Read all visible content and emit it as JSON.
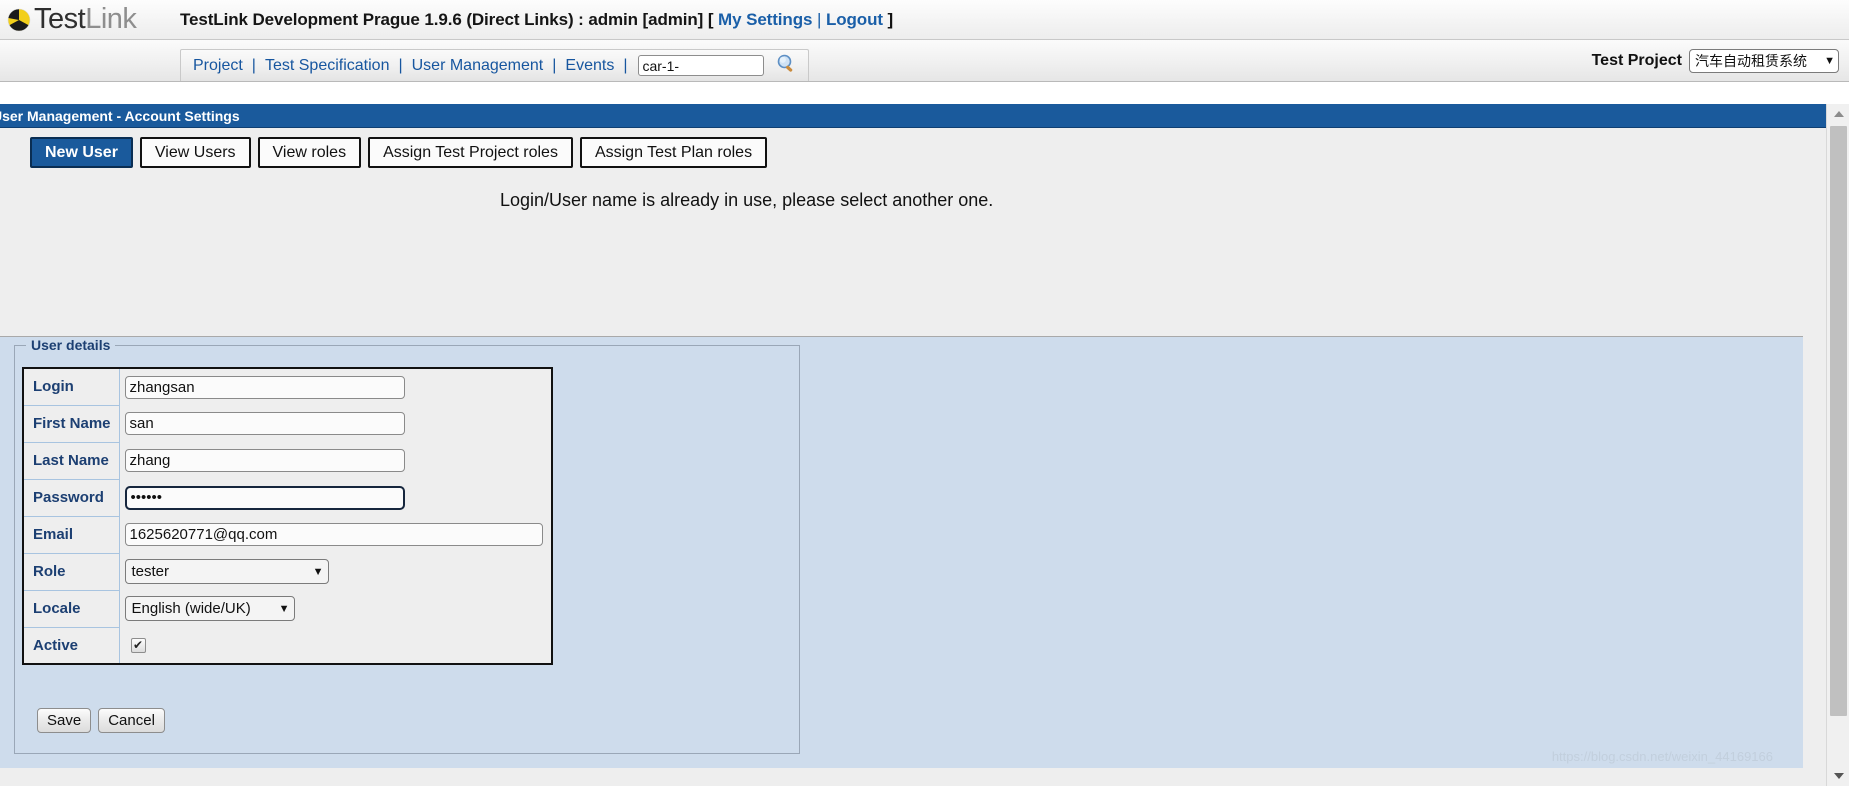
{
  "header": {
    "logo_text_dark": "Test",
    "logo_text_light": "Link",
    "logo_icon": "testlink-pie-logo",
    "title_main": "TestLink Development Prague 1.9.6 (Direct Links) : admin [admin]",
    "bracket_open": "[",
    "bracket_close": "]",
    "my_settings": "My Settings",
    "pipe": "|",
    "logout": "Logout"
  },
  "nav": {
    "items": [
      {
        "label": "Project"
      },
      {
        "label": "Test Specification"
      },
      {
        "label": "User Management"
      },
      {
        "label": "Events"
      }
    ],
    "separator": "|",
    "search_value": "car-1-",
    "search_placeholder": "",
    "search_icon": "magnifier-icon",
    "project_label": "Test Project",
    "project_value": "汽车自动租赁系统",
    "caret": "▼"
  },
  "page": {
    "breadcrumb_title": "User Management - Account Settings",
    "message": "Login/User name is already in use, please select another one.",
    "watermark": "https://blog.csdn.net/weixin_44169166"
  },
  "tabs": [
    {
      "label": "New User",
      "active": true
    },
    {
      "label": "View Users",
      "active": false
    },
    {
      "label": "View roles",
      "active": false
    },
    {
      "label": "Assign Test Project roles",
      "active": false
    },
    {
      "label": "Assign Test Plan roles",
      "active": false
    }
  ],
  "form": {
    "legend": "User details",
    "fields": {
      "login": {
        "label": "Login",
        "value": "zhangsan"
      },
      "first_name": {
        "label": "First Name",
        "value": "san"
      },
      "last_name": {
        "label": "Last Name",
        "value": "zhang"
      },
      "password": {
        "label": "Password",
        "value": "••••••"
      },
      "email": {
        "label": "Email",
        "value": "1625620771@qq.com"
      },
      "role": {
        "label": "Role",
        "value": "tester"
      },
      "locale": {
        "label": "Locale",
        "value": "English (wide/UK)"
      },
      "active": {
        "label": "Active",
        "checked": "✔"
      }
    },
    "buttons": {
      "save": "Save",
      "cancel": "Cancel"
    }
  },
  "colors": {
    "accent_blue": "#1a5a9c",
    "link_blue": "#17569f",
    "panel_blue": "#cedcec",
    "label_blue": "#1c3f72"
  }
}
